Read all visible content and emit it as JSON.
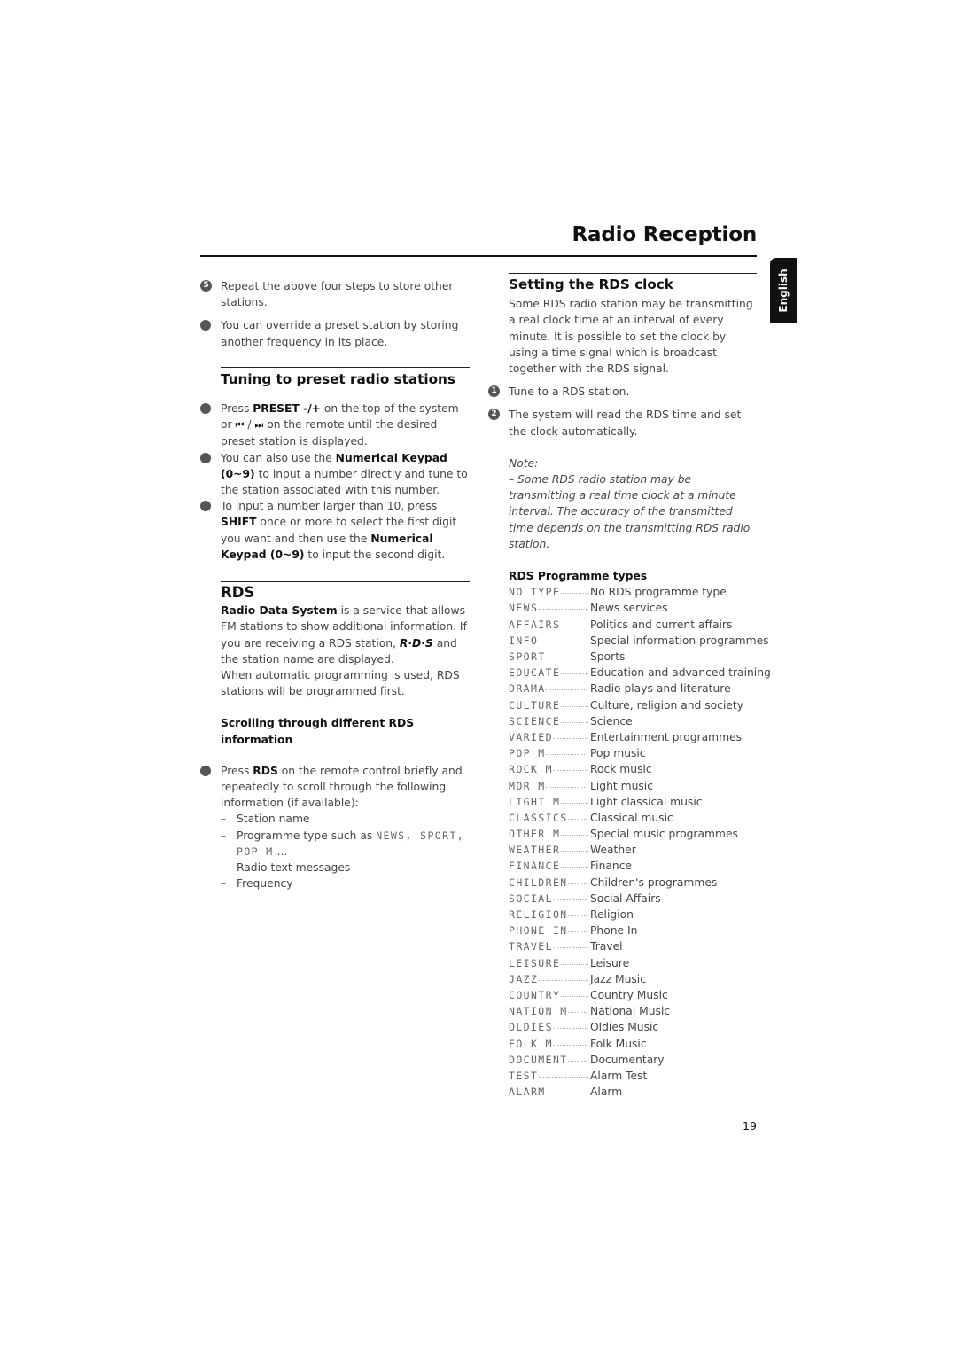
{
  "header": {
    "title": "Radio Reception",
    "language_tab": "English"
  },
  "left": {
    "step5": {
      "marker": "5",
      "text": "Repeat the above four steps to store other stations."
    },
    "override_bullet": "You can override a preset station by storing another frequency in its place.",
    "tuning_section": {
      "heading": "Tuning to preset radio stations",
      "bullet1": {
        "pre": "Press ",
        "bold1": "PRESET -/+",
        "mid": "  on the top of the system or ",
        "prev_icon": "⏮",
        "sep": " / ",
        "next_icon": "⏭",
        "post": "  on the remote until the desired preset station is displayed."
      },
      "bullet2": {
        "pre": "You can also use the ",
        "bold1": "Numerical Keypad (0~9)",
        "post": " to input a number directly and tune to the station associated with this number."
      },
      "bullet3": {
        "pre": "To input a number larger than 10, press ",
        "bold1": "SHIFT",
        "mid": " once or more to select the first digit you want and then use the ",
        "bold2": "Numerical Keypad (0~9)",
        "post": " to input the second digit."
      }
    },
    "rds_section": {
      "heading": "RDS",
      "para1": {
        "bold": "Radio Data System",
        "text1": " is a service that allows FM stations to show additional information. If you are receiving a RDS station, ",
        "rds_logo": "R·D·S",
        "text2": " and the station name are displayed."
      },
      "para2": "When automatic programming is used, RDS stations will be programmed first.",
      "scroll_heading": "Scrolling through different RDS information",
      "scroll_bullet": {
        "pre": "Press ",
        "bold": "RDS",
        "post": " on the remote control briefly and repeatedly to scroll through the following information (if available):"
      },
      "scroll_list": {
        "item1": "Station name",
        "item2_pre": "Programme type such as ",
        "item2_lcd": "NEWS, SPORT, POP M",
        "item2_post": " ...",
        "item3": "Radio text messages",
        "item4": "Frequency"
      }
    }
  },
  "right": {
    "clock_section": {
      "heading": "Setting the RDS clock",
      "intro": "Some RDS radio station may be transmitting a real clock time at an interval of every minute.  It is possible to set the clock by using a time signal which is broadcast together with the RDS signal.",
      "step1": {
        "marker": "1",
        "text": "Tune to a RDS station."
      },
      "step2": {
        "marker": "2",
        "text": "The system will read the RDS time and set the clock automatically."
      },
      "note_label": "Note:",
      "note_text": "–  Some RDS radio station may be transmitting a real time clock at a minute interval. The accuracy of the transmitted time depends on the transmitting RDS radio station."
    },
    "ptypes_heading": "RDS Programme types",
    "ptypes": [
      {
        "code": "NO TYPE",
        "desc": "No RDS programme type"
      },
      {
        "code": "NEWS",
        "desc": "News services"
      },
      {
        "code": "AFFAIRS",
        "desc": "Politics and current affairs"
      },
      {
        "code": "INFO",
        "desc": "Special information programmes"
      },
      {
        "code": "SPORT",
        "desc": "Sports"
      },
      {
        "code": "EDUCATE",
        "desc": "Education and advanced training"
      },
      {
        "code": "DRAMA",
        "desc": "Radio plays and literature"
      },
      {
        "code": "CULTURE",
        "desc": "Culture, religion and society"
      },
      {
        "code": "SCIENCE",
        "desc": "Science"
      },
      {
        "code": "VARIED",
        "desc": "Entertainment programmes"
      },
      {
        "code": "POP M",
        "desc": "Pop music"
      },
      {
        "code": "ROCK M",
        "desc": "Rock music"
      },
      {
        "code": "MOR M",
        "desc": "Light music"
      },
      {
        "code": "LIGHT M",
        "desc": "Light classical music"
      },
      {
        "code": "CLASSICS",
        "desc": "Classical music"
      },
      {
        "code": "OTHER M",
        "desc": "Special music programmes"
      },
      {
        "code": "WEATHER",
        "desc": "Weather"
      },
      {
        "code": "FINANCE",
        "desc": "Finance"
      },
      {
        "code": "CHILDREN",
        "desc": "Children's programmes"
      },
      {
        "code": "SOCIAL",
        "desc": "Social Affairs"
      },
      {
        "code": "RELIGION",
        "desc": "Religion"
      },
      {
        "code": "PHONE IN",
        "desc": "Phone In"
      },
      {
        "code": "TRAVEL",
        "desc": "Travel"
      },
      {
        "code": "LEISURE",
        "desc": "Leisure"
      },
      {
        "code": "JAZZ",
        "desc": "Jazz Music"
      },
      {
        "code": "COUNTRY",
        "desc": "Country Music"
      },
      {
        "code": "NATION M",
        "desc": "National Music"
      },
      {
        "code": "OLDIES",
        "desc": "Oldies Music"
      },
      {
        "code": "FOLK M",
        "desc": "Folk Music"
      },
      {
        "code": "DOCUMENT",
        "desc": "Documentary"
      },
      {
        "code": "TEST",
        "desc": "Alarm Test"
      },
      {
        "code": "ALARM",
        "desc": "Alarm"
      }
    ]
  },
  "footer": {
    "page_number": "19"
  }
}
